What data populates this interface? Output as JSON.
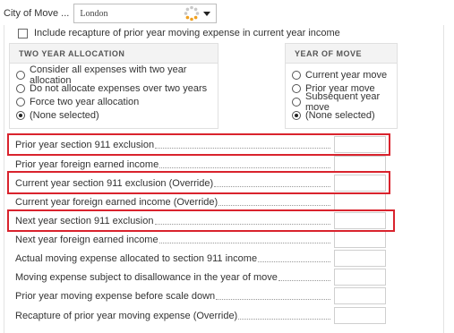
{
  "city": {
    "label": "City of Move ...",
    "value": "London"
  },
  "recapture_checkbox": {
    "label": "Include recapture of prior year moving expense in current year income",
    "checked": false
  },
  "two_year_allocation": {
    "title": "TWO YEAR ALLOCATION",
    "options": [
      {
        "label": "Consider all expenses with two year allocation",
        "selected": false
      },
      {
        "label": "Do not allocate expenses over two years",
        "selected": false
      },
      {
        "label": "Force two year allocation",
        "selected": false
      },
      {
        "label": "(None selected)",
        "selected": true
      }
    ]
  },
  "year_of_move": {
    "title": "YEAR OF MOVE",
    "options": [
      {
        "label": "Current year move",
        "selected": false
      },
      {
        "label": "Prior year move",
        "selected": false
      },
      {
        "label": "Subsequent year move",
        "selected": false
      },
      {
        "label": "(None selected)",
        "selected": true
      }
    ]
  },
  "fields": [
    {
      "label": "Prior year section 911 exclusion",
      "value": "",
      "highlighted": true
    },
    {
      "label": "Prior year foreign earned income",
      "value": "",
      "highlighted": false
    },
    {
      "label": "Current year section 911 exclusion (Override)",
      "value": "",
      "highlighted": true
    },
    {
      "label": "Current year foreign earned income (Override)",
      "value": "",
      "highlighted": false
    },
    {
      "label": "Next year section 911 exclusion",
      "value": "",
      "highlighted": true
    },
    {
      "label": "Next year foreign earned income",
      "value": "",
      "highlighted": false
    },
    {
      "label": "Actual moving expense allocated to section 911 income",
      "value": "",
      "highlighted": false
    },
    {
      "label": "Moving expense subject to disallowance in the year of move",
      "value": "",
      "highlighted": false
    },
    {
      "label": "Prior year moving expense before scale down",
      "value": "",
      "highlighted": false
    },
    {
      "label": "Recapture of prior year moving expense (Override)",
      "value": "",
      "highlighted": false
    }
  ],
  "colors": {
    "highlight": "#d9232d",
    "group_header": "#f3f3f3",
    "border": "#e0e0e0"
  }
}
